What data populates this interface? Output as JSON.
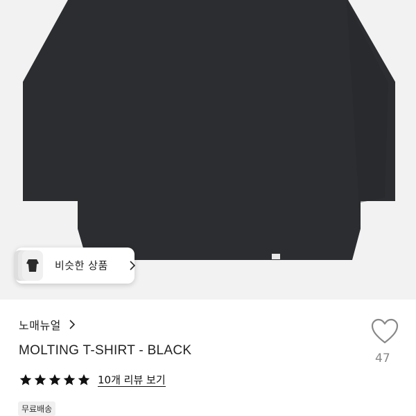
{
  "product": {
    "brand": "노매뉴얼",
    "title": "MOLTING T-SHIRT - BLACK",
    "review_label": "10개 리뷰 보기",
    "rating_stars": 5,
    "badge": "무료배송"
  },
  "similar": {
    "label": "비슷한 상품"
  },
  "likes": {
    "count": "47"
  },
  "icons": {
    "heart": "heart-icon",
    "chevron": "chevron-right-icon",
    "star": "star-icon"
  },
  "colors": {
    "shirt": "#2b2d30",
    "image_bg": "#f2f2f2",
    "like_gray": "#888888",
    "text": "#222222"
  }
}
